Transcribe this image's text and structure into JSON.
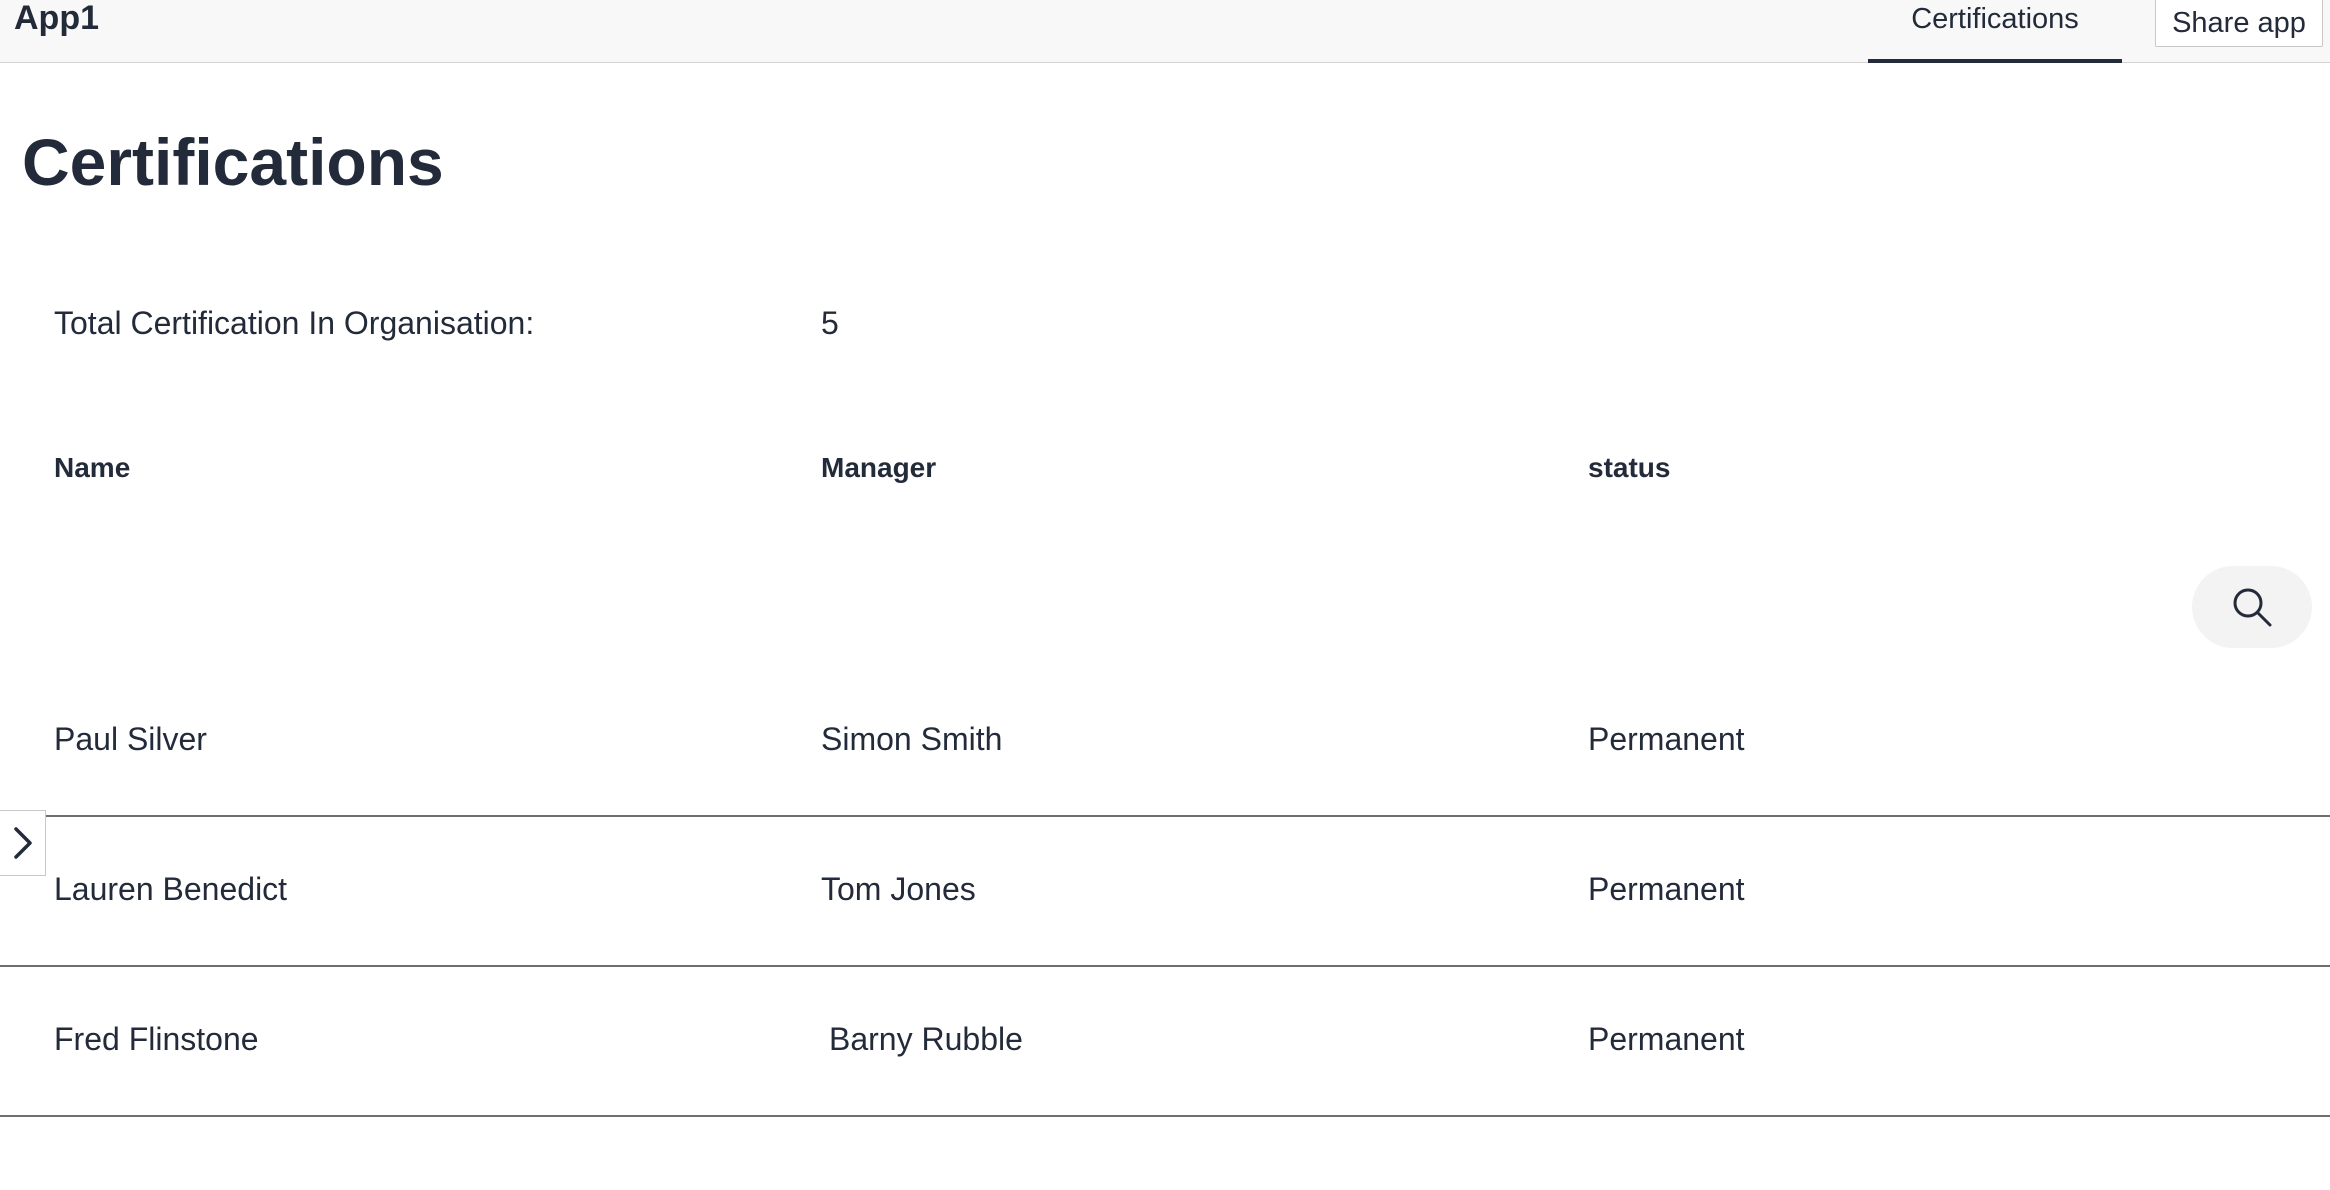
{
  "header": {
    "app_name": "App1",
    "nav_tab": "Certifications",
    "share_label": "Share app"
  },
  "page": {
    "title": "Certifications",
    "total_label": "Total Certification In Organisation:",
    "total_value": "5"
  },
  "table": {
    "columns": [
      "Name",
      "Manager",
      "status"
    ],
    "rows": [
      {
        "name": "Paul Silver",
        "manager": "Simon Smith",
        "status": "Permanent"
      },
      {
        "name": "Lauren Benedict",
        "manager": "Tom Jones",
        "status": "Permanent"
      },
      {
        "name": "Fred Flinstone",
        "manager": "Barny Rubble",
        "status": "Permanent"
      }
    ]
  },
  "icons": {
    "search": "search-icon",
    "expand": "chevron-right-icon"
  },
  "colors": {
    "text": "#232b3a",
    "header_bg": "#f8f8f8",
    "row_divider": "#6f6f6f"
  }
}
